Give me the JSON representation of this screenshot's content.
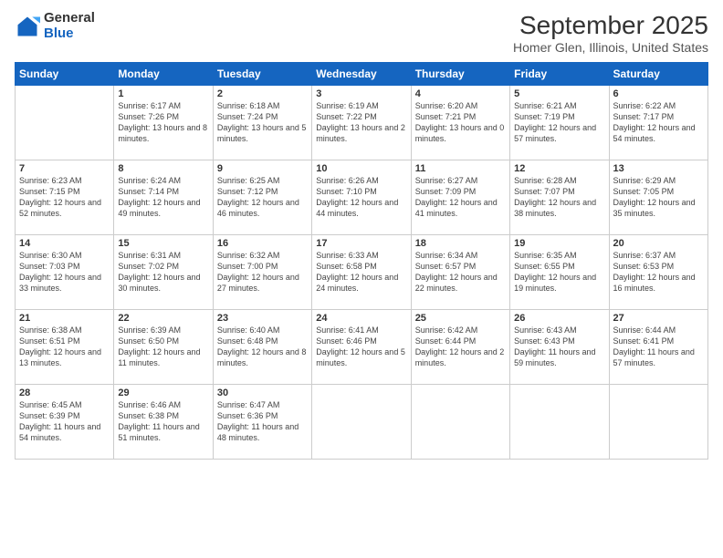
{
  "logo": {
    "general": "General",
    "blue": "Blue"
  },
  "header": {
    "month": "September 2025",
    "location": "Homer Glen, Illinois, United States"
  },
  "weekdays": [
    "Sunday",
    "Monday",
    "Tuesday",
    "Wednesday",
    "Thursday",
    "Friday",
    "Saturday"
  ],
  "weeks": [
    [
      {
        "day": "",
        "sunrise": "",
        "sunset": "",
        "daylight": ""
      },
      {
        "day": "1",
        "sunrise": "Sunrise: 6:17 AM",
        "sunset": "Sunset: 7:26 PM",
        "daylight": "Daylight: 13 hours and 8 minutes."
      },
      {
        "day": "2",
        "sunrise": "Sunrise: 6:18 AM",
        "sunset": "Sunset: 7:24 PM",
        "daylight": "Daylight: 13 hours and 5 minutes."
      },
      {
        "day": "3",
        "sunrise": "Sunrise: 6:19 AM",
        "sunset": "Sunset: 7:22 PM",
        "daylight": "Daylight: 13 hours and 2 minutes."
      },
      {
        "day": "4",
        "sunrise": "Sunrise: 6:20 AM",
        "sunset": "Sunset: 7:21 PM",
        "daylight": "Daylight: 13 hours and 0 minutes."
      },
      {
        "day": "5",
        "sunrise": "Sunrise: 6:21 AM",
        "sunset": "Sunset: 7:19 PM",
        "daylight": "Daylight: 12 hours and 57 minutes."
      },
      {
        "day": "6",
        "sunrise": "Sunrise: 6:22 AM",
        "sunset": "Sunset: 7:17 PM",
        "daylight": "Daylight: 12 hours and 54 minutes."
      }
    ],
    [
      {
        "day": "7",
        "sunrise": "Sunrise: 6:23 AM",
        "sunset": "Sunset: 7:15 PM",
        "daylight": "Daylight: 12 hours and 52 minutes."
      },
      {
        "day": "8",
        "sunrise": "Sunrise: 6:24 AM",
        "sunset": "Sunset: 7:14 PM",
        "daylight": "Daylight: 12 hours and 49 minutes."
      },
      {
        "day": "9",
        "sunrise": "Sunrise: 6:25 AM",
        "sunset": "Sunset: 7:12 PM",
        "daylight": "Daylight: 12 hours and 46 minutes."
      },
      {
        "day": "10",
        "sunrise": "Sunrise: 6:26 AM",
        "sunset": "Sunset: 7:10 PM",
        "daylight": "Daylight: 12 hours and 44 minutes."
      },
      {
        "day": "11",
        "sunrise": "Sunrise: 6:27 AM",
        "sunset": "Sunset: 7:09 PM",
        "daylight": "Daylight: 12 hours and 41 minutes."
      },
      {
        "day": "12",
        "sunrise": "Sunrise: 6:28 AM",
        "sunset": "Sunset: 7:07 PM",
        "daylight": "Daylight: 12 hours and 38 minutes."
      },
      {
        "day": "13",
        "sunrise": "Sunrise: 6:29 AM",
        "sunset": "Sunset: 7:05 PM",
        "daylight": "Daylight: 12 hours and 35 minutes."
      }
    ],
    [
      {
        "day": "14",
        "sunrise": "Sunrise: 6:30 AM",
        "sunset": "Sunset: 7:03 PM",
        "daylight": "Daylight: 12 hours and 33 minutes."
      },
      {
        "day": "15",
        "sunrise": "Sunrise: 6:31 AM",
        "sunset": "Sunset: 7:02 PM",
        "daylight": "Daylight: 12 hours and 30 minutes."
      },
      {
        "day": "16",
        "sunrise": "Sunrise: 6:32 AM",
        "sunset": "Sunset: 7:00 PM",
        "daylight": "Daylight: 12 hours and 27 minutes."
      },
      {
        "day": "17",
        "sunrise": "Sunrise: 6:33 AM",
        "sunset": "Sunset: 6:58 PM",
        "daylight": "Daylight: 12 hours and 24 minutes."
      },
      {
        "day": "18",
        "sunrise": "Sunrise: 6:34 AM",
        "sunset": "Sunset: 6:57 PM",
        "daylight": "Daylight: 12 hours and 22 minutes."
      },
      {
        "day": "19",
        "sunrise": "Sunrise: 6:35 AM",
        "sunset": "Sunset: 6:55 PM",
        "daylight": "Daylight: 12 hours and 19 minutes."
      },
      {
        "day": "20",
        "sunrise": "Sunrise: 6:37 AM",
        "sunset": "Sunset: 6:53 PM",
        "daylight": "Daylight: 12 hours and 16 minutes."
      }
    ],
    [
      {
        "day": "21",
        "sunrise": "Sunrise: 6:38 AM",
        "sunset": "Sunset: 6:51 PM",
        "daylight": "Daylight: 12 hours and 13 minutes."
      },
      {
        "day": "22",
        "sunrise": "Sunrise: 6:39 AM",
        "sunset": "Sunset: 6:50 PM",
        "daylight": "Daylight: 12 hours and 11 minutes."
      },
      {
        "day": "23",
        "sunrise": "Sunrise: 6:40 AM",
        "sunset": "Sunset: 6:48 PM",
        "daylight": "Daylight: 12 hours and 8 minutes."
      },
      {
        "day": "24",
        "sunrise": "Sunrise: 6:41 AM",
        "sunset": "Sunset: 6:46 PM",
        "daylight": "Daylight: 12 hours and 5 minutes."
      },
      {
        "day": "25",
        "sunrise": "Sunrise: 6:42 AM",
        "sunset": "Sunset: 6:44 PM",
        "daylight": "Daylight: 12 hours and 2 minutes."
      },
      {
        "day": "26",
        "sunrise": "Sunrise: 6:43 AM",
        "sunset": "Sunset: 6:43 PM",
        "daylight": "Daylight: 11 hours and 59 minutes."
      },
      {
        "day": "27",
        "sunrise": "Sunrise: 6:44 AM",
        "sunset": "Sunset: 6:41 PM",
        "daylight": "Daylight: 11 hours and 57 minutes."
      }
    ],
    [
      {
        "day": "28",
        "sunrise": "Sunrise: 6:45 AM",
        "sunset": "Sunset: 6:39 PM",
        "daylight": "Daylight: 11 hours and 54 minutes."
      },
      {
        "day": "29",
        "sunrise": "Sunrise: 6:46 AM",
        "sunset": "Sunset: 6:38 PM",
        "daylight": "Daylight: 11 hours and 51 minutes."
      },
      {
        "day": "30",
        "sunrise": "Sunrise: 6:47 AM",
        "sunset": "Sunset: 6:36 PM",
        "daylight": "Daylight: 11 hours and 48 minutes."
      },
      {
        "day": "",
        "sunrise": "",
        "sunset": "",
        "daylight": ""
      },
      {
        "day": "",
        "sunrise": "",
        "sunset": "",
        "daylight": ""
      },
      {
        "day": "",
        "sunrise": "",
        "sunset": "",
        "daylight": ""
      },
      {
        "day": "",
        "sunrise": "",
        "sunset": "",
        "daylight": ""
      }
    ]
  ]
}
